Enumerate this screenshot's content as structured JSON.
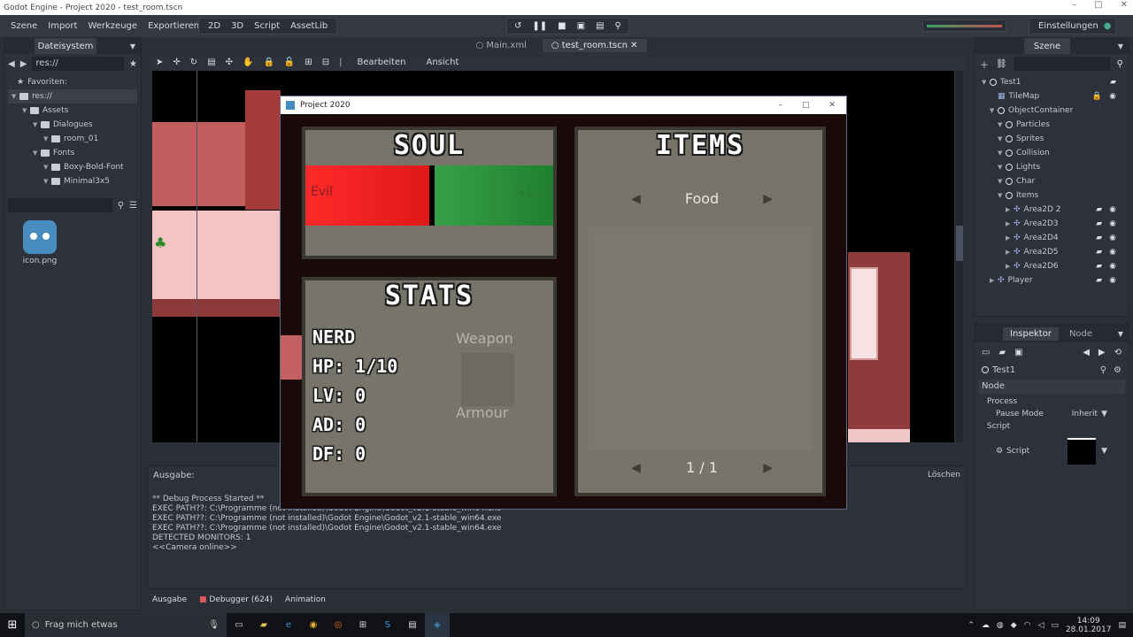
{
  "window": {
    "title": "Godot Engine - Project 2020 - test_room.tscn",
    "controls": [
      "–",
      "□",
      "✕"
    ]
  },
  "menu": {
    "items": [
      "Szene",
      "Import",
      "Werkzeuge",
      "Exportieren"
    ],
    "modes": [
      "2D",
      "3D",
      "Script",
      "AssetLib"
    ],
    "settings": "Einstellungen"
  },
  "filesystem": {
    "tab": "Dateisystem",
    "path": "res://",
    "favorites": "Favoriten:",
    "tree": [
      {
        "label": "res://",
        "indent": 0,
        "kind": "folder"
      },
      {
        "label": "Assets",
        "indent": 1,
        "kind": "folder"
      },
      {
        "label": "Dialogues",
        "indent": 2,
        "kind": "folder"
      },
      {
        "label": "room_01",
        "indent": 3,
        "kind": "folder"
      },
      {
        "label": "Fonts",
        "indent": 2,
        "kind": "folder"
      },
      {
        "label": "Boxy-Bold-Font",
        "indent": 3,
        "kind": "folder"
      },
      {
        "label": "Minimal3x5",
        "indent": 3,
        "kind": "folder"
      }
    ],
    "file": "icon.png"
  },
  "editor": {
    "tabs": [
      "Main.xml",
      "test_room.tscn"
    ],
    "toolbar_menus": [
      "Bearbeiten",
      "Ansicht"
    ]
  },
  "game_window": {
    "title": "Project 2020",
    "soul": {
      "title": "SOUL",
      "left": "Evil",
      "right": "Good",
      "evil_fraction": 0.5
    },
    "stats": {
      "title": "STATS",
      "name": "NERD",
      "hp": "HP: 1/10",
      "lv": "LV: 0",
      "ad": "AD: 0",
      "df": "DF: 0",
      "weapon": "Weapon",
      "armour": "Armour"
    },
    "items": {
      "title": "ITEMS",
      "category": "Food",
      "page": "1 / 1"
    }
  },
  "output": {
    "title": "Ausgabe:",
    "clear": "Löschen",
    "lines": [
      "** Debug Process Started **",
      "EXEC PATH??: C:\\Programme (not installed)\\Godot Engine\\Godot_v2.1-stable_win64.exe",
      "EXEC PATH??: C:\\Programme (not installed)\\Godot Engine\\Godot_v2.1-stable_win64.exe",
      "EXEC PATH??: C:\\Programme (not installed)\\Godot Engine\\Godot_v2.1-stable_win64.exe",
      "DETECTED MONITORS: 1",
      "<<Camera online>>"
    ],
    "bottom_tabs": [
      "Ausgabe",
      "Debugger (624)",
      "Animation"
    ]
  },
  "scene": {
    "tab": "Szene",
    "nodes": [
      {
        "label": "Test1",
        "indent": 0,
        "icon": "o"
      },
      {
        "label": "TileMap",
        "indent": 1,
        "icon": "grid"
      },
      {
        "label": "ObjectContainer",
        "indent": 1,
        "icon": "o"
      },
      {
        "label": "Particles",
        "indent": 2,
        "icon": "o"
      },
      {
        "label": "Sprites",
        "indent": 2,
        "icon": "o"
      },
      {
        "label": "Collision",
        "indent": 2,
        "icon": "o"
      },
      {
        "label": "Lights",
        "indent": 2,
        "icon": "o"
      },
      {
        "label": "Char",
        "indent": 2,
        "icon": "o"
      },
      {
        "label": "Items",
        "indent": 2,
        "icon": "o"
      },
      {
        "label": "Area2D 2",
        "indent": 3,
        "icon": "x"
      },
      {
        "label": "Area2D3",
        "indent": 3,
        "icon": "x"
      },
      {
        "label": "Area2D4",
        "indent": 3,
        "icon": "x"
      },
      {
        "label": "Area2D5",
        "indent": 3,
        "icon": "x"
      },
      {
        "label": "Area2D6",
        "indent": 3,
        "icon": "x"
      },
      {
        "label": "Player",
        "indent": 1,
        "icon": "x"
      }
    ]
  },
  "inspector": {
    "tabs": [
      "Inspektor",
      "Node"
    ],
    "node": "Test1",
    "section": "Node",
    "process": "Process",
    "pause_mode_label": "Pause Mode",
    "pause_mode_value": "Inherit",
    "script_section": "Script",
    "script_label": "Script"
  },
  "taskbar": {
    "search": "Frag mich etwas",
    "time": "14:09",
    "date": "28.01.2017"
  },
  "colors": {
    "evil": "#ee2222",
    "good": "#2a9a3a",
    "panel": "#77746a"
  }
}
